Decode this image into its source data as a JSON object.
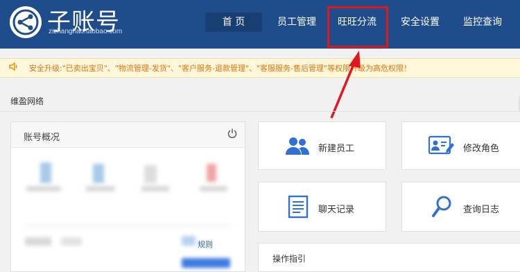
{
  "header": {
    "logo_title": "子账号",
    "logo_sub": "zizhanghao.taobao.com",
    "nav": [
      {
        "label": "首 页"
      },
      {
        "label": "员工管理"
      },
      {
        "label": "旺旺分流"
      },
      {
        "label": "安全设置"
      },
      {
        "label": "监控查询"
      }
    ]
  },
  "notice": {
    "icon": "speaker-icon",
    "text": "安全升级:\"已卖出宝贝\"、\"物流管理-发货\"、\"客户服务-退款管理\"、\"客服服务-售后管理\"等权限升级为高危权限！"
  },
  "section": {
    "title": "维盈网络"
  },
  "account_panel": {
    "title": "账号概况",
    "link": "规则"
  },
  "cards": [
    {
      "label": "新建员工",
      "icon": "users-icon"
    },
    {
      "label": "修改角色",
      "icon": "id-card-icon"
    },
    {
      "label": "聊天记录",
      "icon": "document-icon"
    },
    {
      "label": "查询日志",
      "icon": "search-icon"
    }
  ],
  "guide": {
    "title": "操作指引"
  },
  "colors": {
    "header": "#1f4c8a",
    "highlight": "#e4161b",
    "accent": "#2b62c0",
    "notice_text": "#e2730e"
  }
}
